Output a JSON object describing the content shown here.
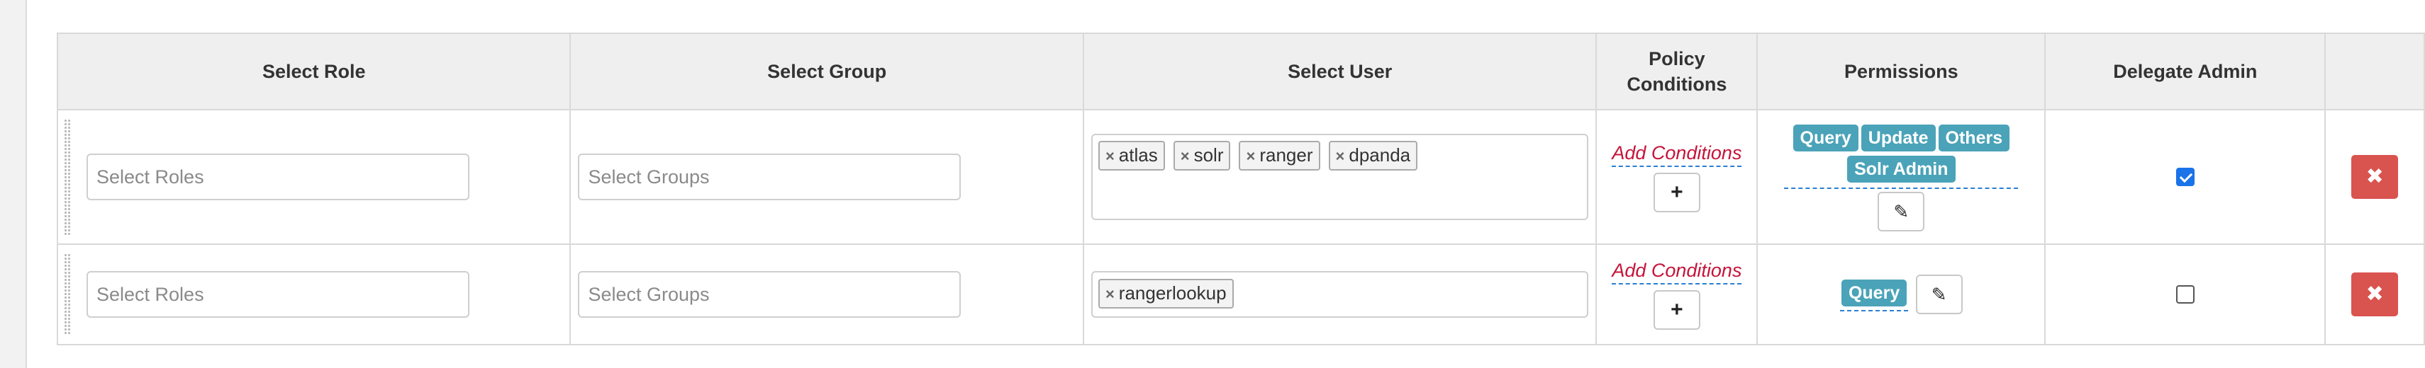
{
  "headers": {
    "role": "Select Role",
    "group": "Select Group",
    "user": "Select User",
    "conditions_line1": "Policy",
    "conditions_line2": "Conditions",
    "permissions": "Permissions",
    "delegate": "Delegate Admin",
    "actions": ""
  },
  "rows": [
    {
      "roles_placeholder": "Select Roles",
      "groups_placeholder": "Select Groups",
      "users": [
        "atlas",
        "solr",
        "ranger",
        "dpanda"
      ],
      "add_conditions": "Add Conditions",
      "permissions": [
        "Query",
        "Update",
        "Others",
        "Solr Admin"
      ],
      "delegate_admin": true
    },
    {
      "roles_placeholder": "Select Roles",
      "groups_placeholder": "Select Groups",
      "users": [
        "rangerlookup"
      ],
      "add_conditions": "Add Conditions",
      "permissions": [
        "Query"
      ],
      "delegate_admin": false
    }
  ],
  "icons": {
    "remove_tag": "×",
    "add": "+",
    "edit": "✎",
    "delete": "✖"
  },
  "colors": {
    "permission_badge": "#4aa3b8",
    "delete_button": "#d9534f",
    "add_conditions_text": "#c5143a",
    "checkbox_checked": "#1a73e8"
  }
}
